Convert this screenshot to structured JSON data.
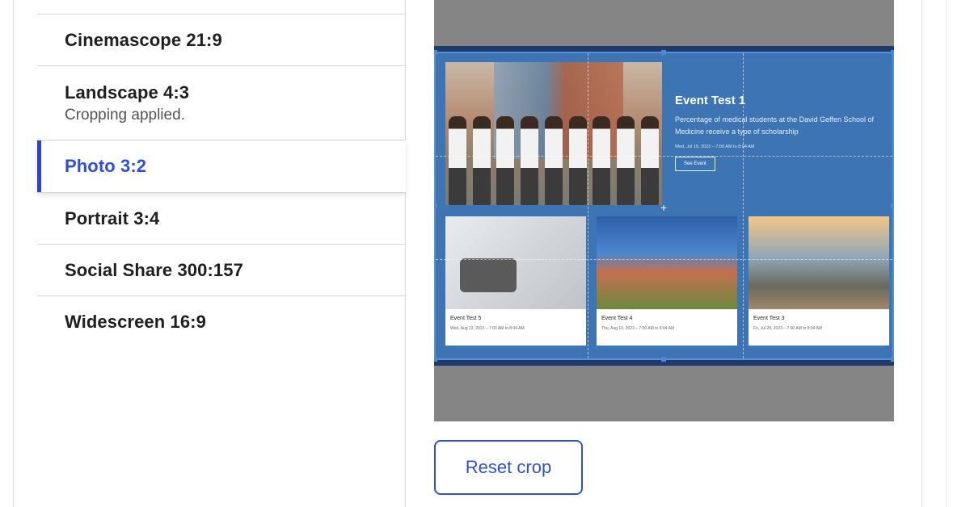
{
  "crop_types": [
    {
      "label": "Cinemascope 21:9",
      "sub": ""
    },
    {
      "label": "Landscape 4:3",
      "sub": "Cropping applied."
    },
    {
      "label": "Photo 3:2",
      "sub": ""
    },
    {
      "label": "Portrait 3:4",
      "sub": ""
    },
    {
      "label": "Social Share 300:157",
      "sub": ""
    },
    {
      "label": "Widescreen 16:9",
      "sub": ""
    }
  ],
  "active_index": 2,
  "preview": {
    "hero_title": "Event Test 1",
    "hero_description": "Percentage of medical students at the David Geffen School of Medicine receive a type of scholarship",
    "hero_date": "Wed, Jul 19, 2023 – 7:00 AM to 8:04 AM",
    "hero_button": "See Event",
    "cards": [
      {
        "title": "Event Test 5",
        "date": "Wed, Aug 23, 2023 – 7:00 AM to 8:04 AM"
      },
      {
        "title": "Event Test 4",
        "date": "Thu, Aug 10, 2023 – 7:00 AM to 8:04 AM"
      },
      {
        "title": "Event Test 3",
        "date": "Fri, Jul 28, 2023 – 7:00 AM to 8:04 AM"
      }
    ]
  },
  "reset_button": "Reset crop",
  "colors": {
    "accent": "#2f4fd6",
    "crop_overlay": "#3d74b4",
    "preview_bg": "#858585"
  }
}
